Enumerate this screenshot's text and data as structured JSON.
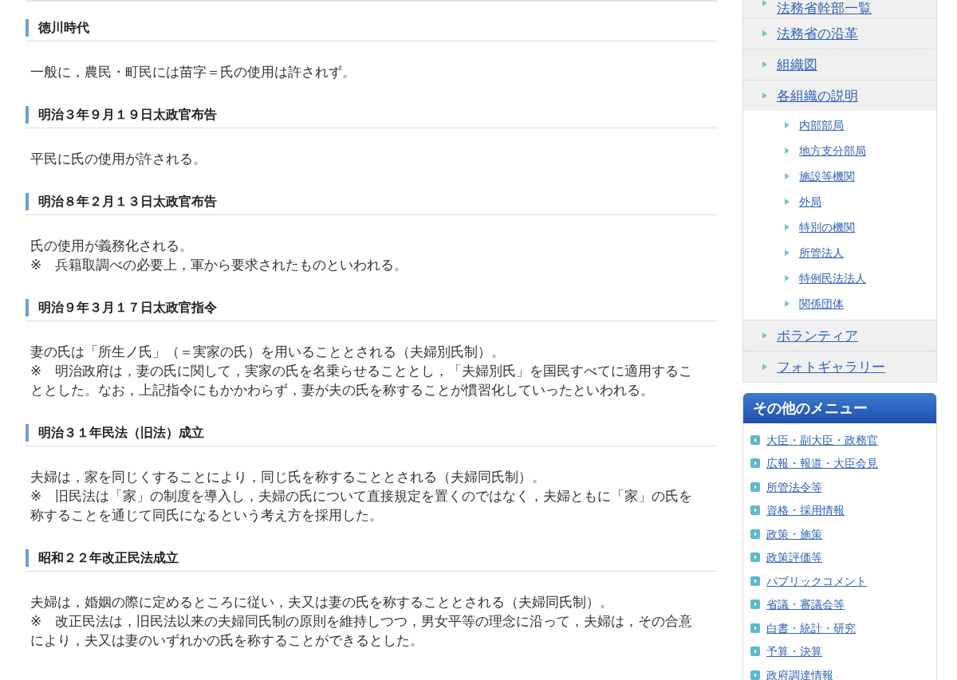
{
  "sections": [
    {
      "heading": "徳川時代",
      "paragraphs": [
        "一般に，農民・町民には苗字＝氏の使用は許されず。"
      ]
    },
    {
      "heading": "明治３年９月１９日太政官布告",
      "paragraphs": [
        "平民に氏の使用が許される。"
      ]
    },
    {
      "heading": "明治８年２月１３日太政官布告",
      "paragraphs": [
        "氏の使用が義務化される。",
        "※　兵籍取調べの必要上，軍から要求されたものといわれる。"
      ]
    },
    {
      "heading": "明治９年３月１７日太政官指令",
      "paragraphs": [
        "妻の氏は「所生ノ氏」（＝実家の氏）を用いることとされる（夫婦別氏制）。",
        "※　明治政府は，妻の氏に関して，実家の氏を名乗らせることとし，「夫婦別氏」を国民すべてに適用することとした。なお，上記指令にもかかわらず，妻が夫の氏を称することが慣習化していったといわれる。"
      ]
    },
    {
      "heading": "明治３１年民法（旧法）成立",
      "paragraphs": [
        "夫婦は，家を同じくすることにより，同じ氏を称することとされる（夫婦同氏制）。",
        "※　旧民法は「家」の制度を導入し，夫婦の氏について直接規定を置くのではなく，夫婦ともに「家」の氏を称することを通じて同氏になるという考え方を採用した。"
      ]
    },
    {
      "heading": "昭和２２年改正民法成立",
      "paragraphs": [
        "夫婦は，婚姻の際に定めるところに従い，夫又は妻の氏を称することとされる（夫婦同氏制）。",
        "※　改正民法は，旧民法以来の夫婦同氏制の原則を維持しつつ，男女平等の理念に沿って，夫婦は，その合意により，夫又は妻のいずれかの氏を称することができるとした。"
      ]
    }
  ],
  "sidebar": {
    "nav": [
      {
        "label": "法務省幹部一覧"
      },
      {
        "label": "法務省の沿革"
      },
      {
        "label": "組織図"
      },
      {
        "label": "各組織の説明",
        "children": [
          {
            "label": "内部部局"
          },
          {
            "label": "地方支分部局"
          },
          {
            "label": "施設等機関"
          },
          {
            "label": "外局"
          },
          {
            "label": "特別の機関"
          },
          {
            "label": "所管法人"
          },
          {
            "label": "特例民法法人"
          },
          {
            "label": "関係団体"
          }
        ]
      },
      {
        "label": "ボランティア"
      },
      {
        "label": "フォトギャラリー"
      }
    ],
    "other_menu": {
      "title": "その他のメニュー",
      "items": [
        "大臣・副大臣・政務官",
        "広報・報道・大臣会見",
        "所管法令等",
        "資格・採用情報",
        "政策・施策",
        "政策評価等",
        "パブリックコメント",
        "省議・審議会等",
        "白書・統計・研究",
        "予算・決算",
        "政府調達情報"
      ]
    }
  }
}
